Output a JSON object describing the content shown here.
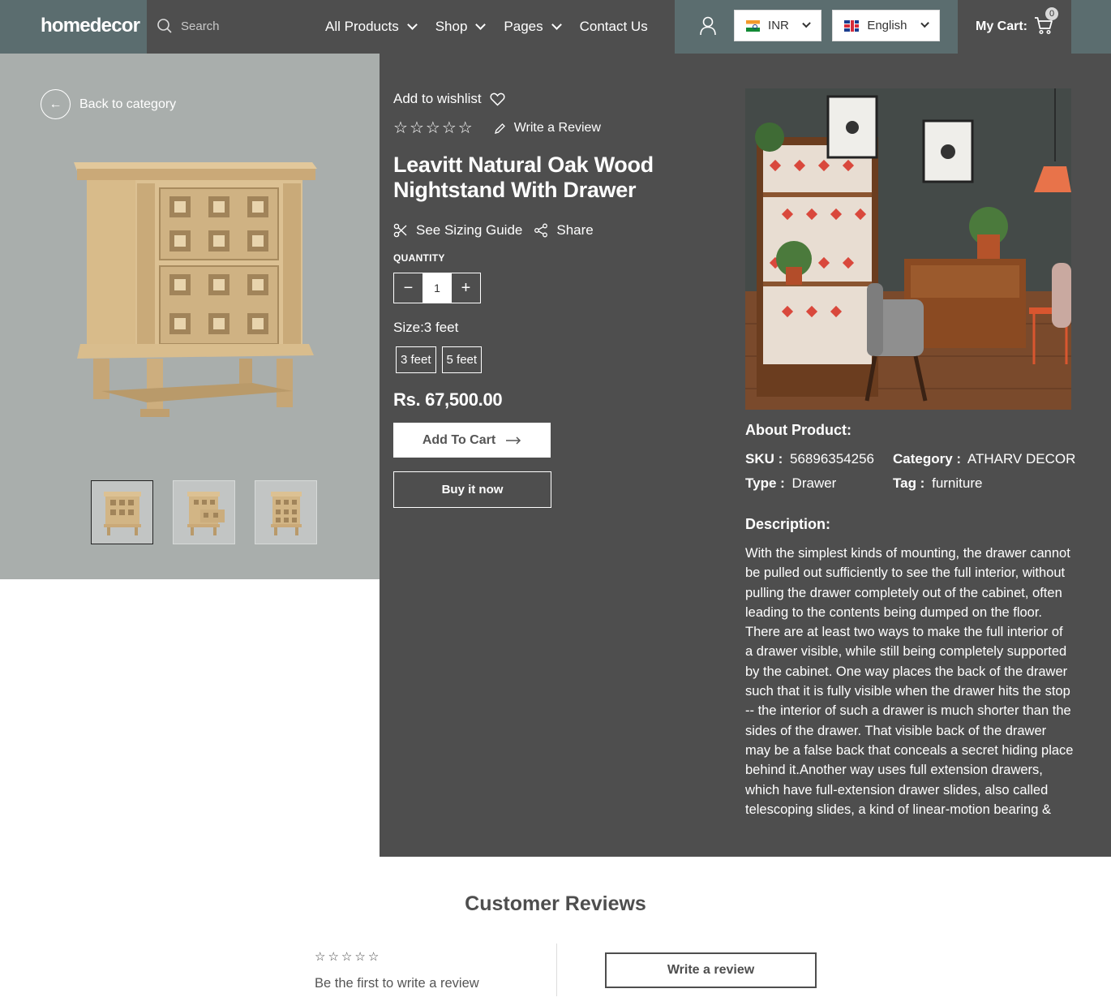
{
  "header": {
    "logo": "homedecor",
    "search_placeholder": "Search",
    "nav": [
      {
        "label": "All Products"
      },
      {
        "label": "Shop"
      },
      {
        "label": "Pages"
      },
      {
        "label": "Contact Us"
      }
    ],
    "currency": "INR",
    "language": "English",
    "cart_label": "My Cart:",
    "cart_count": "0"
  },
  "gallery": {
    "back_label": "Back to category",
    "thumbnail_count": 3,
    "active_thumbnail": 1
  },
  "product": {
    "wishlist_label": "Add to wishlist",
    "rating_stars": 5,
    "write_review_label": "Write a Review",
    "title": "Leavitt Natural Oak Wood Nightstand With Drawer",
    "sizing_guide_label": "See Sizing Guide",
    "share_label": "Share",
    "quantity_label": "QUANTITY",
    "quantity": "1",
    "size_label": "Size:3 feet",
    "sizes": [
      "3 feet",
      "5 feet"
    ],
    "price": "Rs. 67,500.00",
    "add_to_cart_label": "Add To Cart",
    "buy_now_label": "Buy it now"
  },
  "about": {
    "title": "About Product:",
    "sku_label": "SKU :",
    "sku": "56896354256",
    "category_label": "Category :",
    "category": "ATHARV DECOR",
    "type_label": "Type :",
    "type": "Drawer",
    "tag_label": "Tag :",
    "tag": "furniture",
    "description_title": "Description:",
    "description": "With the simplest kinds of mounting, the drawer cannot be pulled out sufficiently to see the full interior, without pulling the drawer completely out of the cabinet, often leading to the contents being dumped on the floor. There are at least two ways to make the full interior of a drawer visible, while still being completely supported by the cabinet. One way places the back of the drawer such that it is fully visible when the drawer hits the stop -- the interior of such a drawer is much shorter than the sides of the drawer. That visible back of the drawer may be a false back that conceals a secret hiding place behind it.Another way uses full extension drawers, which have full-extension drawer slides, also called telescoping slides, a kind of linear-motion bearing &"
  },
  "reviews": {
    "title": "Customer Reviews",
    "empty_text": "Be the first to write a review",
    "write_button_label": "Write a review"
  },
  "colors": {
    "header_teal": "#5b6d6f",
    "panel_dark": "#4e4e4e",
    "gallery_bg": "#a9aeac"
  }
}
